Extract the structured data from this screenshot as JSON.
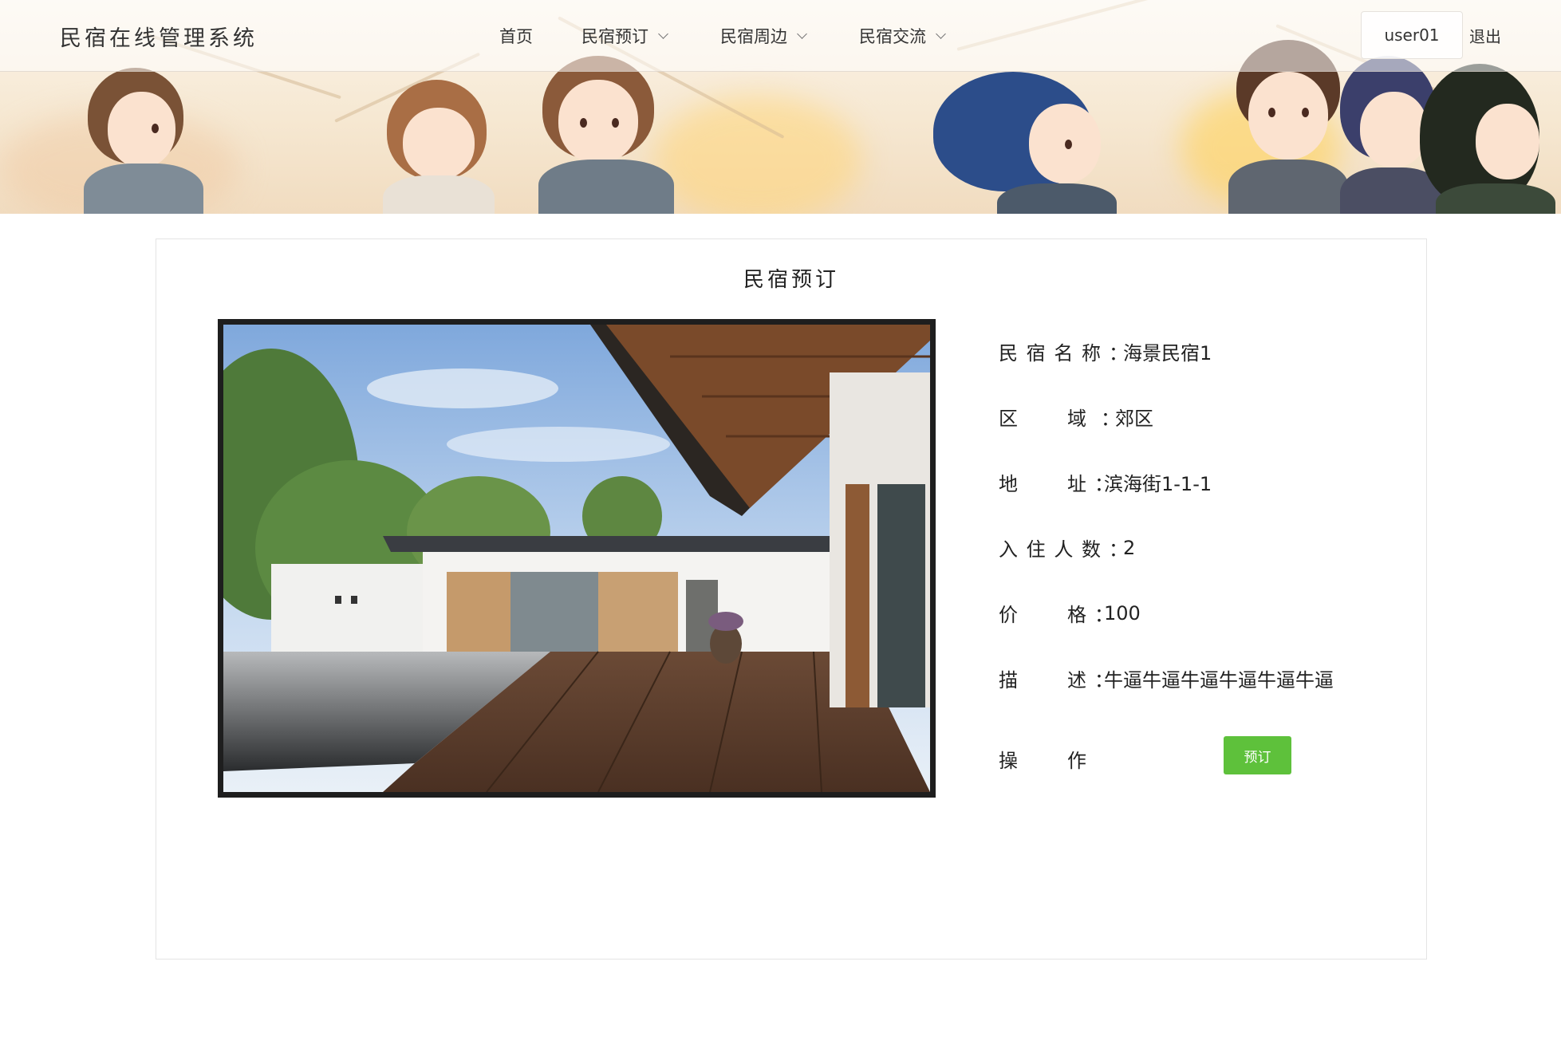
{
  "header": {
    "brand": "民宿在线管理系统",
    "nav": [
      {
        "label": "首页",
        "has_dropdown": false
      },
      {
        "label": "民宿预订",
        "has_dropdown": true
      },
      {
        "label": "民宿周边",
        "has_dropdown": true
      },
      {
        "label": "民宿交流",
        "has_dropdown": true
      }
    ],
    "username": "user01",
    "logout_label": "退出"
  },
  "main": {
    "title": "民宿预订",
    "fields": {
      "name": {
        "label_chars": [
          "民",
          "宿",
          "名",
          "称"
        ],
        "value": "海景民宿1"
      },
      "region": {
        "label_chars": [
          "区",
          "域"
        ],
        "value": "郊区"
      },
      "address": {
        "label_chars": [
          "地",
          "址"
        ],
        "value": "滨海街1-1-1"
      },
      "guests": {
        "label_chars": [
          "入",
          "住",
          "人",
          "数"
        ],
        "value": "2"
      },
      "price": {
        "label_chars": [
          "价",
          "格"
        ],
        "value": "100"
      },
      "description": {
        "label_chars": [
          "描",
          "述"
        ],
        "value": "牛逼牛逼牛逼牛逼牛逼牛逼"
      },
      "action": {
        "label_chars": [
          "操",
          "作"
        ]
      }
    },
    "book_button_label": "预订",
    "accent_color": "#5ec13b"
  }
}
